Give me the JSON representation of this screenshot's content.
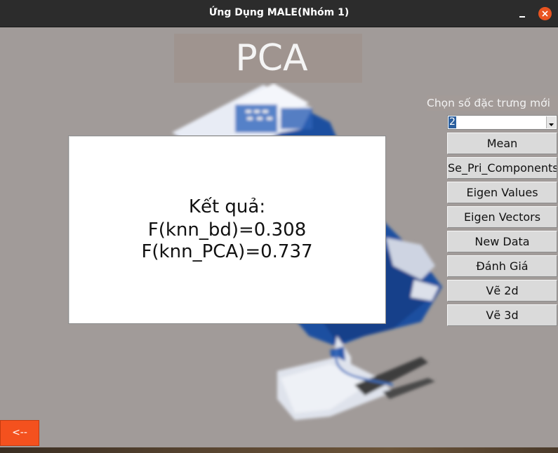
{
  "window": {
    "title": "Ứng Dụng MALE(Nhóm 1)",
    "minimize_icon": "minimize-icon",
    "close_icon": "close-icon",
    "accent": "#e95420"
  },
  "header": {
    "title": "PCA"
  },
  "feature_chooser": {
    "label": "Chọn số đặc trưng mới",
    "selected_value": "2"
  },
  "actions": [
    {
      "name": "mean-button",
      "label": "Mean"
    },
    {
      "name": "se-pri-components-button",
      "label": "Se_Pri_Components"
    },
    {
      "name": "eigen-values-button",
      "label": "Eigen Values"
    },
    {
      "name": "eigen-vectors-button",
      "label": "Eigen Vectors"
    },
    {
      "name": "new-data-button",
      "label": "New Data"
    },
    {
      "name": "danh-gia-button",
      "label": "Đánh Giá"
    },
    {
      "name": "ve-2d-button",
      "label": "Vẽ 2d"
    },
    {
      "name": "ve-3d-button",
      "label": "Vẽ 3d"
    }
  ],
  "result": {
    "heading": "Kết quả:",
    "knn_bd": "F(knn_bd)=0.308",
    "knn_pca": "F(knn_PCA)=0.737"
  },
  "navigation": {
    "back_label": "<--",
    "back_color": "#f4511e"
  },
  "colors": {
    "background": "#a19b99",
    "titlebar": "#2c2c2c",
    "illustration_blue": "#1f4fa0"
  }
}
